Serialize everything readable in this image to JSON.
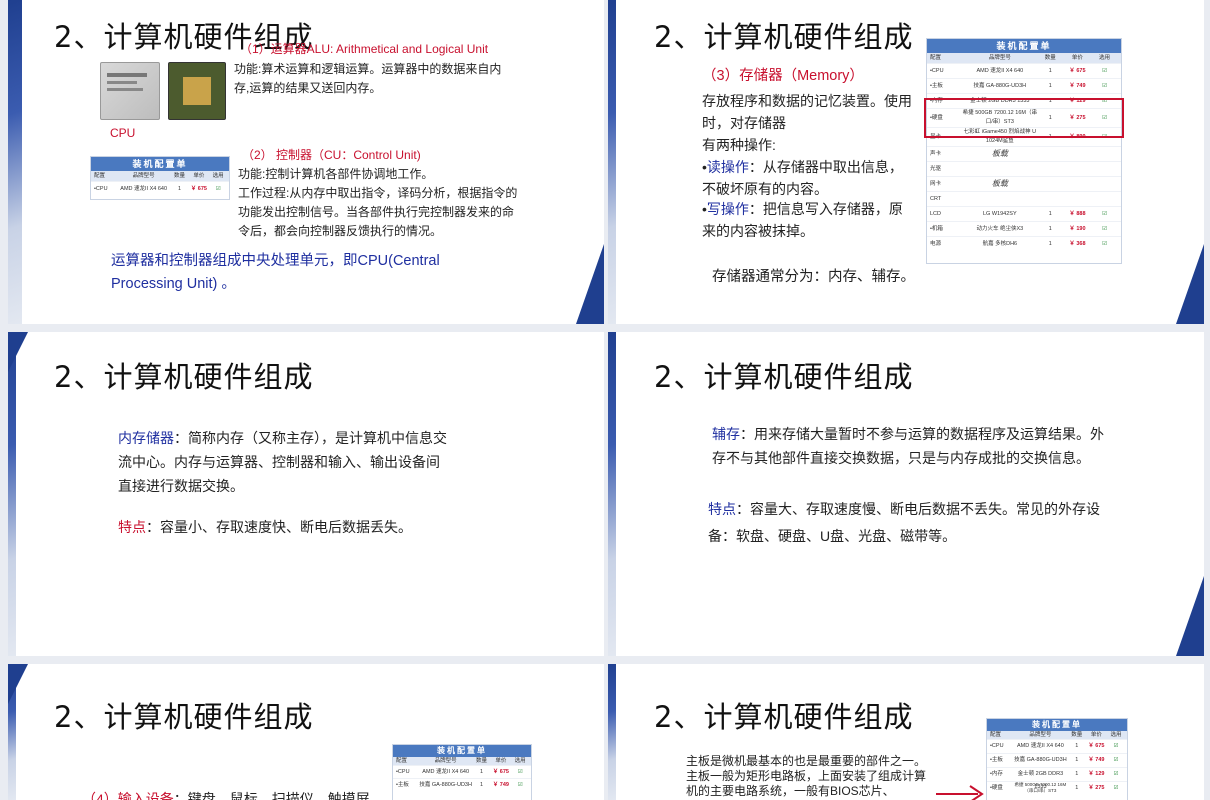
{
  "slides": [
    {
      "title": "2、计算机硬件组成",
      "alu_heading": "（1）运算器ALU: Arithmetical and Logical Unit",
      "alu_desc": "功能:算术运算和逻辑运算。运算器中的数据来自内存,运算的结果又送回内存。",
      "cpu_label": "CPU",
      "cu_heading": "（2） 控制器（CU：Control Unit)",
      "cu_desc1": "功能:控制计算机各部件协调地工作。",
      "cu_desc2": "工作过程:从内存中取出指令，译码分析，根据指令的功能发出控制信号。当各部件执行完控制器发来的命令后，都会向控制器反馈执行的情况。",
      "summary": "运算器和控制器组成中央处理单元，即CPU(Central Processing Unit) 。"
    },
    {
      "title": "2、计算机硬件组成",
      "mem_heading": "（3）存储器（Memory）",
      "mem_p1": "存放程序和数据的记忆装置。使用时，对存储器",
      "mem_p2": "有两种操作:",
      "read_label": "读操作",
      "read_desc": "：从存储器中取出信息，不破坏原有的内容。",
      "write_label": "写操作",
      "write_desc": "：把信息写入存储器，原来的内容被抹掉。",
      "mem_footer": "存储器通常分为：内存、辅存。"
    },
    {
      "title": "2、计算机硬件组成",
      "ram_label": "内存储器",
      "ram_desc": "：简称内存（又称主存），是计算机中信息交流中心。内存与运算器、控制器和输入、输出设备间直接进行数据交换。",
      "feat_label": "特点",
      "feat_desc": "：容量小、存取速度快、断电后数据丢失。"
    },
    {
      "title": "2、计算机硬件组成",
      "aux_label": "辅存",
      "aux_desc": "：用来存储大量暂时不参与运算的数据程序及运算结果。外存不与其他部件直接交换数据，只是与内存成批的交换信息。",
      "feat_label": "特点",
      "feat_desc": "：容量大、存取速度慢、断电后数据不丢失。常见的外存设备：软盘、硬盘、U盘、光盘、磁带等。"
    },
    {
      "title": "2、计算机硬件组成",
      "input_heading": "（4）输入设备",
      "input_desc": "：键盘、鼠标、扫描仪、触摸屏等"
    },
    {
      "title": "2、计算机硬件组成",
      "board_desc": "主板是微机最基本的也是最重要的部件之一。主板一般为矩形电路板，上面安装了组成计算机的主要电路系统，一般有BIOS芯片、"
    }
  ],
  "config_table": {
    "title": "装机配置单",
    "columns": [
      "配置",
      "品牌型号",
      "数量",
      "单价",
      "选用"
    ],
    "rows": [
      {
        "part": "•CPU",
        "model": "AMD 速龙II X4 640",
        "qty": "1",
        "price": "￥ 675",
        "check": "☑"
      },
      {
        "part": "•主板",
        "model": "技嘉 GA-880G-UD3H",
        "qty": "1",
        "price": "￥ 749",
        "check": "☑"
      },
      {
        "part": "•内存",
        "model": "金士顿 2GB DDR3 1333",
        "qty": "1",
        "price": "￥ 129",
        "check": "☑"
      },
      {
        "part": "•硬盘",
        "model": "希捷 500GB 7200.12 16M（串口/串）ST3",
        "qty": "1",
        "price": "￥ 275",
        "check": "☑"
      },
      {
        "part": "显卡",
        "model": "七彩虹 iGame450 烈焰战神 U 1024M鲨鱼",
        "qty": "1",
        "price": "￥ 899",
        "check": "☑"
      },
      {
        "part": "声卡",
        "model": "板载",
        "qty": "",
        "price": "",
        "check": ""
      },
      {
        "part": "光驱",
        "model": "",
        "qty": "",
        "price": "",
        "check": ""
      },
      {
        "part": "网卡",
        "model": "板载",
        "qty": "",
        "price": "",
        "check": ""
      },
      {
        "part": "CRT",
        "model": "",
        "qty": "",
        "price": "",
        "check": ""
      },
      {
        "part": "LCD",
        "model": "LG W1942SY",
        "qty": "1",
        "price": "￥ 888",
        "check": "☑"
      },
      {
        "part": "•机箱",
        "model": "动力火车 绝尘侠X3",
        "qty": "1",
        "price": "￥ 190",
        "check": "☑"
      },
      {
        "part": "电源",
        "model": "航嘉 多核DH6",
        "qty": "1",
        "price": "￥ 368",
        "check": "☑"
      }
    ]
  }
}
